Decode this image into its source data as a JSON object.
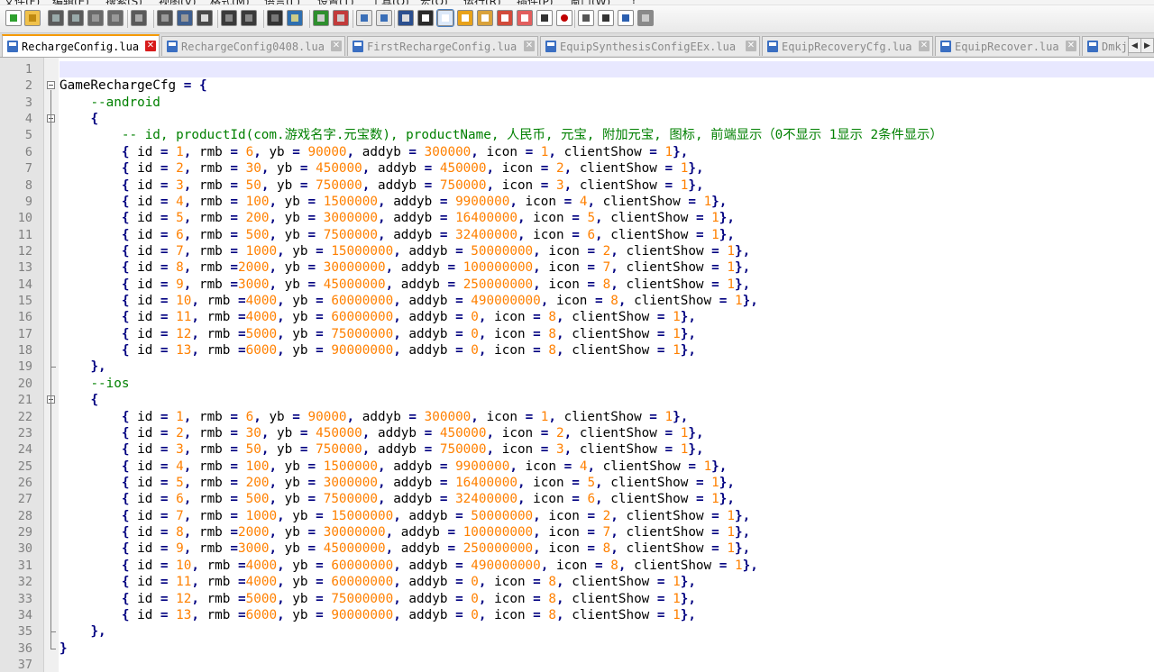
{
  "colors": {
    "number": "#ff8000",
    "comment": "#008000",
    "operator": "#000080",
    "active_tab_accent": "#f59a00",
    "tab_close_active": "#d81b1b"
  },
  "menu": [
    "文件(F)",
    "编辑(E)",
    "搜索(S)",
    "视图(V)",
    "格式(M)",
    "语言(L)",
    "设置(T)",
    "工具(O)",
    "宏(O)",
    "运行(R)",
    "插件(P)",
    "窗口(W)",
    "?"
  ],
  "toolbar_icons": [
    "new-file-icon",
    "open-file-icon",
    "save-icon",
    "save-all-icon",
    "close-icon",
    "close-all-icon",
    "print-icon",
    "cut-icon",
    "copy-icon",
    "paste-icon",
    "undo-icon",
    "redo-icon",
    "find-icon",
    "replace-icon",
    "zoom-in-icon",
    "zoom-out-icon",
    "sync-vertical-icon",
    "sync-horizontal-icon",
    "word-wrap-icon",
    "show-all-chars-icon",
    "indent-guide-icon",
    "document-map-icon",
    "function-list-icon",
    "folder-workspace-icon",
    "user-define-language-icon",
    "monitor-icon",
    "record-macro-icon",
    "stop-record-icon",
    "play-macro-icon",
    "run-macro-multiple-icon",
    "save-macro-icon"
  ],
  "tabs": [
    {
      "label": "RechargeConfig.lua",
      "active": true
    },
    {
      "label": "RechargeConfig0408.lua",
      "active": false
    },
    {
      "label": "FirstRechargeConfig.lua",
      "active": false
    },
    {
      "label": "EquipSynthesisConfigEEx.lua",
      "active": false
    },
    {
      "label": "EquipRecoveryCfg.lua",
      "active": false
    },
    {
      "label": "EquipRecover.lua",
      "active": false
    },
    {
      "label": "Dmkj",
      "active": false
    }
  ],
  "lines": [
    {
      "n": "1",
      "t": ""
    },
    {
      "n": "2",
      "t": "GameRechargeCfg = {"
    },
    {
      "n": "3",
      "t": "    --android"
    },
    {
      "n": "4",
      "t": "    {"
    },
    {
      "n": "5",
      "t": "        -- id, productId(com.游戏名字.元宝数), productName, 人民币, 元宝, 附加元宝, 图标, 前端显示（0不显示 1显示 2条件显示）"
    },
    {
      "n": "6",
      "t": "        { id = 1, rmb = 6, yb = 90000, addyb = 300000, icon = 1, clientShow = 1},"
    },
    {
      "n": "7",
      "t": "        { id = 2, rmb = 30, yb = 450000, addyb = 450000, icon = 2, clientShow = 1},"
    },
    {
      "n": "8",
      "t": "        { id = 3, rmb = 50, yb = 750000, addyb = 750000, icon = 3, clientShow = 1},"
    },
    {
      "n": "9",
      "t": "        { id = 4, rmb = 100, yb = 1500000, addyb = 9900000, icon = 4, clientShow = 1},"
    },
    {
      "n": "10",
      "t": "        { id = 5, rmb = 200, yb = 3000000, addyb = 16400000, icon = 5, clientShow = 1},"
    },
    {
      "n": "11",
      "t": "        { id = 6, rmb = 500, yb = 7500000, addyb = 32400000, icon = 6, clientShow = 1},"
    },
    {
      "n": "12",
      "t": "        { id = 7, rmb = 1000, yb = 15000000, addyb = 50000000, icon = 2, clientShow = 1},"
    },
    {
      "n": "13",
      "t": "        { id = 8, rmb =2000, yb = 30000000, addyb = 100000000, icon = 7, clientShow = 1},"
    },
    {
      "n": "14",
      "t": "        { id = 9, rmb =3000, yb = 45000000, addyb = 250000000, icon = 8, clientShow = 1},"
    },
    {
      "n": "15",
      "t": "        { id = 10, rmb =4000, yb = 60000000, addyb = 490000000, icon = 8, clientShow = 1},"
    },
    {
      "n": "16",
      "t": "        { id = 11, rmb =4000, yb = 60000000, addyb = 0, icon = 8, clientShow = 1},"
    },
    {
      "n": "17",
      "t": "        { id = 12, rmb =5000, yb = 75000000, addyb = 0, icon = 8, clientShow = 1},"
    },
    {
      "n": "18",
      "t": "        { id = 13, rmb =6000, yb = 90000000, addyb = 0, icon = 8, clientShow = 1},"
    },
    {
      "n": "19",
      "t": "    },"
    },
    {
      "n": "20",
      "t": "    --ios"
    },
    {
      "n": "21",
      "t": "    {"
    },
    {
      "n": "22",
      "t": "        { id = 1, rmb = 6, yb = 90000, addyb = 300000, icon = 1, clientShow = 1},"
    },
    {
      "n": "23",
      "t": "        { id = 2, rmb = 30, yb = 450000, addyb = 450000, icon = 2, clientShow = 1},"
    },
    {
      "n": "24",
      "t": "        { id = 3, rmb = 50, yb = 750000, addyb = 750000, icon = 3, clientShow = 1},"
    },
    {
      "n": "25",
      "t": "        { id = 4, rmb = 100, yb = 1500000, addyb = 9900000, icon = 4, clientShow = 1},"
    },
    {
      "n": "26",
      "t": "        { id = 5, rmb = 200, yb = 3000000, addyb = 16400000, icon = 5, clientShow = 1},"
    },
    {
      "n": "27",
      "t": "        { id = 6, rmb = 500, yb = 7500000, addyb = 32400000, icon = 6, clientShow = 1},"
    },
    {
      "n": "28",
      "t": "        { id = 7, rmb = 1000, yb = 15000000, addyb = 50000000, icon = 2, clientShow = 1},"
    },
    {
      "n": "29",
      "t": "        { id = 8, rmb =2000, yb = 30000000, addyb = 100000000, icon = 7, clientShow = 1},"
    },
    {
      "n": "30",
      "t": "        { id = 9, rmb =3000, yb = 45000000, addyb = 250000000, icon = 8, clientShow = 1},"
    },
    {
      "n": "31",
      "t": "        { id = 10, rmb =4000, yb = 60000000, addyb = 490000000, icon = 8, clientShow = 1},"
    },
    {
      "n": "32",
      "t": "        { id = 11, rmb =4000, yb = 60000000, addyb = 0, icon = 8, clientShow = 1},"
    },
    {
      "n": "33",
      "t": "        { id = 12, rmb =5000, yb = 75000000, addyb = 0, icon = 8, clientShow = 1},"
    },
    {
      "n": "34",
      "t": "        { id = 13, rmb =6000, yb = 90000000, addyb = 0, icon = 8, clientShow = 1},"
    },
    {
      "n": "35",
      "t": "    },"
    },
    {
      "n": "36",
      "t": "}"
    },
    {
      "n": "37",
      "t": ""
    }
  ]
}
